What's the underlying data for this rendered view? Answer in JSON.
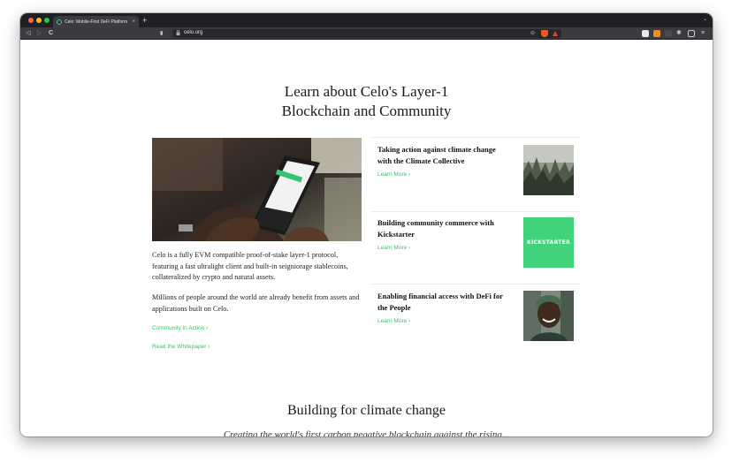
{
  "browser": {
    "tab_title": "Celo: Mobile-First DeFi Platform",
    "tab_close": "×",
    "new_tab": "+",
    "tab_menu": "⌄",
    "url": "celo.org",
    "nav": {
      "back": "◁",
      "forward": "▷",
      "reload": "C",
      "bookmark": "▮",
      "lock": "🔒",
      "zoom": "⊖"
    },
    "colors": {
      "tabbar": "#1f2024",
      "toolbar": "#3a3b40",
      "accent": "#35c46f"
    }
  },
  "section1": {
    "heading_line1": "Learn about Celo's Layer-1",
    "heading_line2": "Blockchain and Community",
    "paragraph1": "Celo is a fully EVM compatible proof-of-stake layer-1 protocol, featuring a fast ultralight client and built-in seigniorage stablecoins, collateralized by crypto and natural assets.",
    "paragraph2": "Millions of people around the world are already benefit from assets and applications built on Celo.",
    "link1": "Community in Action",
    "link2": "Read the Whitepaper",
    "link_chevron": "›"
  },
  "cards": [
    {
      "title": "Taking action against climate change with the Climate Collective",
      "link": "Learn More ›"
    },
    {
      "title": "Building community commerce with Kickstarter",
      "link": "Learn More ›",
      "thumb_text": "KICKSTARTER"
    },
    {
      "title": "Enabling financial access with DeFi for the People",
      "link": "Learn More ›"
    }
  ],
  "section2": {
    "heading": "Building for climate change",
    "subline": "Creating the world's first carbon negative blockchain against the rising..."
  }
}
